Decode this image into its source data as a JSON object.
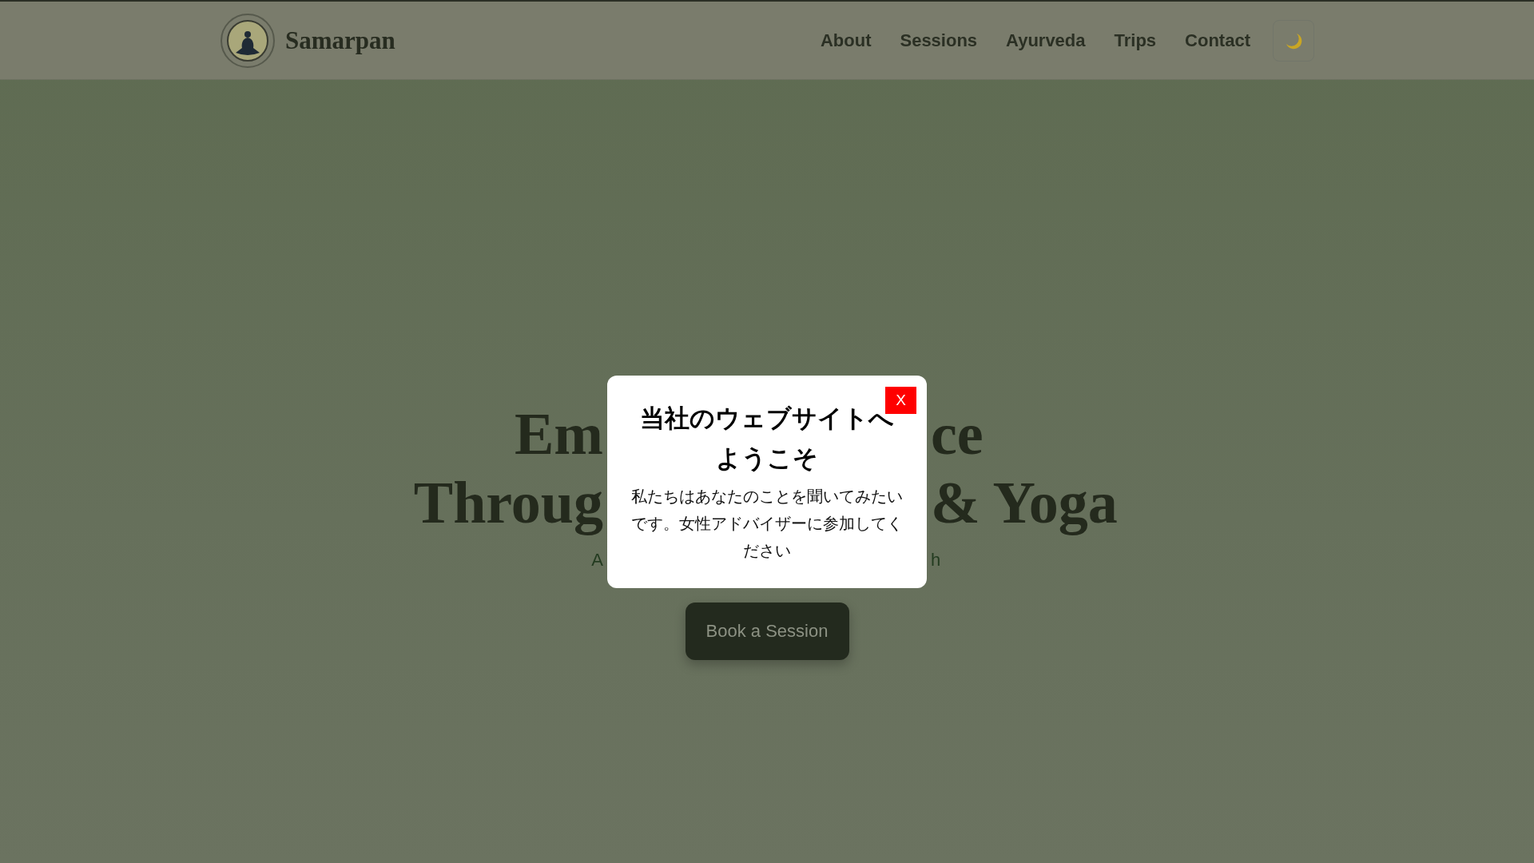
{
  "header": {
    "brand": "Samarpan",
    "nav": [
      {
        "label": "About"
      },
      {
        "label": "Sessions"
      },
      {
        "label": "Ayurveda"
      },
      {
        "label": "Trips"
      },
      {
        "label": "Contact"
      }
    ]
  },
  "hero": {
    "headline_lines": [
      {
        "left": "Em",
        "right": "ce"
      },
      {
        "left": "Throug",
        "right": "& Yoga"
      }
    ],
    "subtitle": {
      "left": "A",
      "right": "h"
    },
    "button": "Book a Session"
  },
  "modal": {
    "title": "当社のウェブサイトへようこそ",
    "body": "私たちはあなたのことを聞いてみたいです。女性アドバイザーに参加してください",
    "close": "X"
  }
}
